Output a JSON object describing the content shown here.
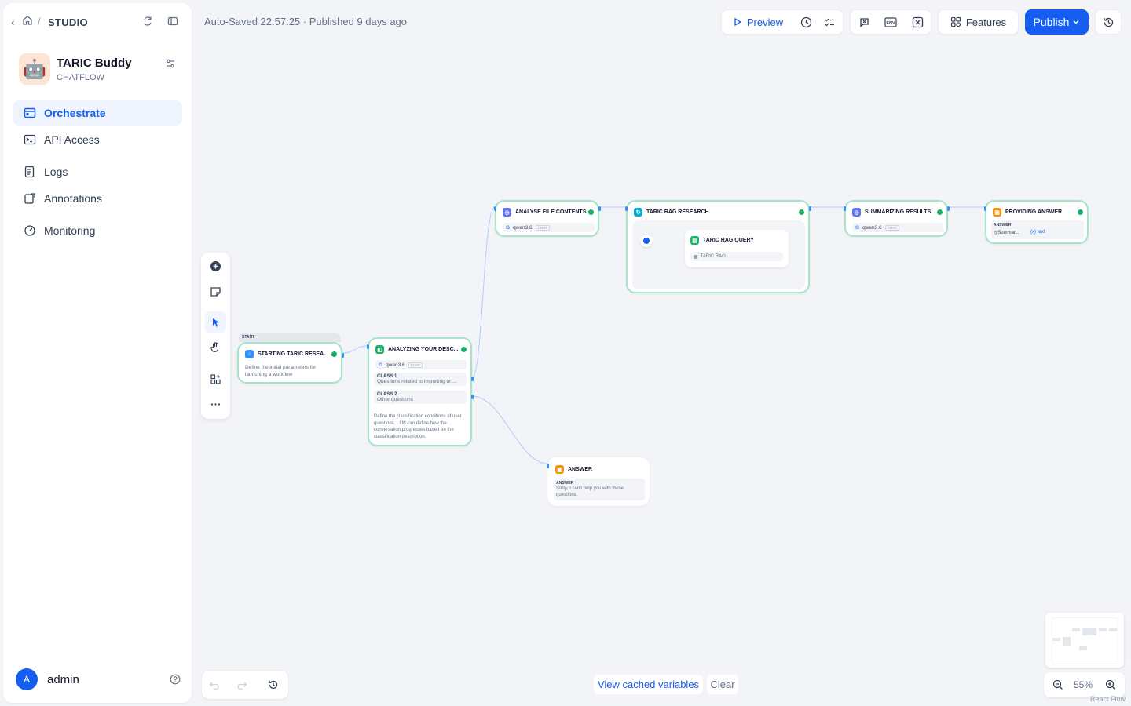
{
  "header": {
    "studio_label": "STUDIO"
  },
  "app": {
    "name": "TARIC Buddy",
    "type": "CHATFLOW",
    "icon": "robot-emoji"
  },
  "nav": {
    "items": [
      {
        "label": "Orchestrate",
        "icon": "orchestrate-icon"
      },
      {
        "label": "API Access",
        "icon": "terminal-icon"
      },
      {
        "label": "Logs",
        "icon": "logs-icon"
      },
      {
        "label": "Annotations",
        "icon": "annotation-icon"
      },
      {
        "label": "Monitoring",
        "icon": "gauge-icon"
      }
    ]
  },
  "user": {
    "initial": "A",
    "name": "admin"
  },
  "status": {
    "text": "Auto-Saved 22:57:25 · Published 9 days ago"
  },
  "toolbar": {
    "preview_label": "Preview",
    "features_label": "Features",
    "publish_label": "Publish",
    "env_label": "ENV"
  },
  "nodes": {
    "start": {
      "tag": "START",
      "title": "STARTING TARIC RESEA...",
      "desc": "Define the initial parameters for launching a workflow"
    },
    "classifier": {
      "title": "ANALYZING YOUR DESC...",
      "model": "qwen3.6",
      "chip": "CHAT",
      "classes": [
        {
          "label": "CLASS 1",
          "text": "Questions related to importing or ..."
        },
        {
          "label": "CLASS 2",
          "text": "Other questions"
        }
      ],
      "desc": "Define the classification conditions of user questions, LLM can define how the conversation progresses based on the classification description."
    },
    "analyse": {
      "title": "ANALYSE FILE CONTENTS",
      "model": "qwen3.6",
      "chip": "CHAT"
    },
    "rag": {
      "title": "TARIC RAG RESEARCH",
      "inner_title": "TARIC RAG QUERY",
      "inner_sub": "TARIC RAG"
    },
    "summary": {
      "title": "SUMMARIZING RESULTS",
      "model": "qwen3.6",
      "chip": "CHAT"
    },
    "providing": {
      "title": "PROVIDING ANSWER",
      "label": "ANSWER",
      "var": "Summar...",
      "var_type": "text"
    },
    "answer": {
      "title": "ANSWER",
      "label": "ANSWER",
      "text": "Sorry, I can't help you with these questions."
    }
  },
  "bottom": {
    "cached_label": "View cached variables",
    "clear_label": "Clear",
    "zoom": "55%",
    "watermark": "React Flow"
  },
  "colors": {
    "accent": "#155eef",
    "node_border": "#a6e4c9",
    "success": "#17b26a"
  }
}
